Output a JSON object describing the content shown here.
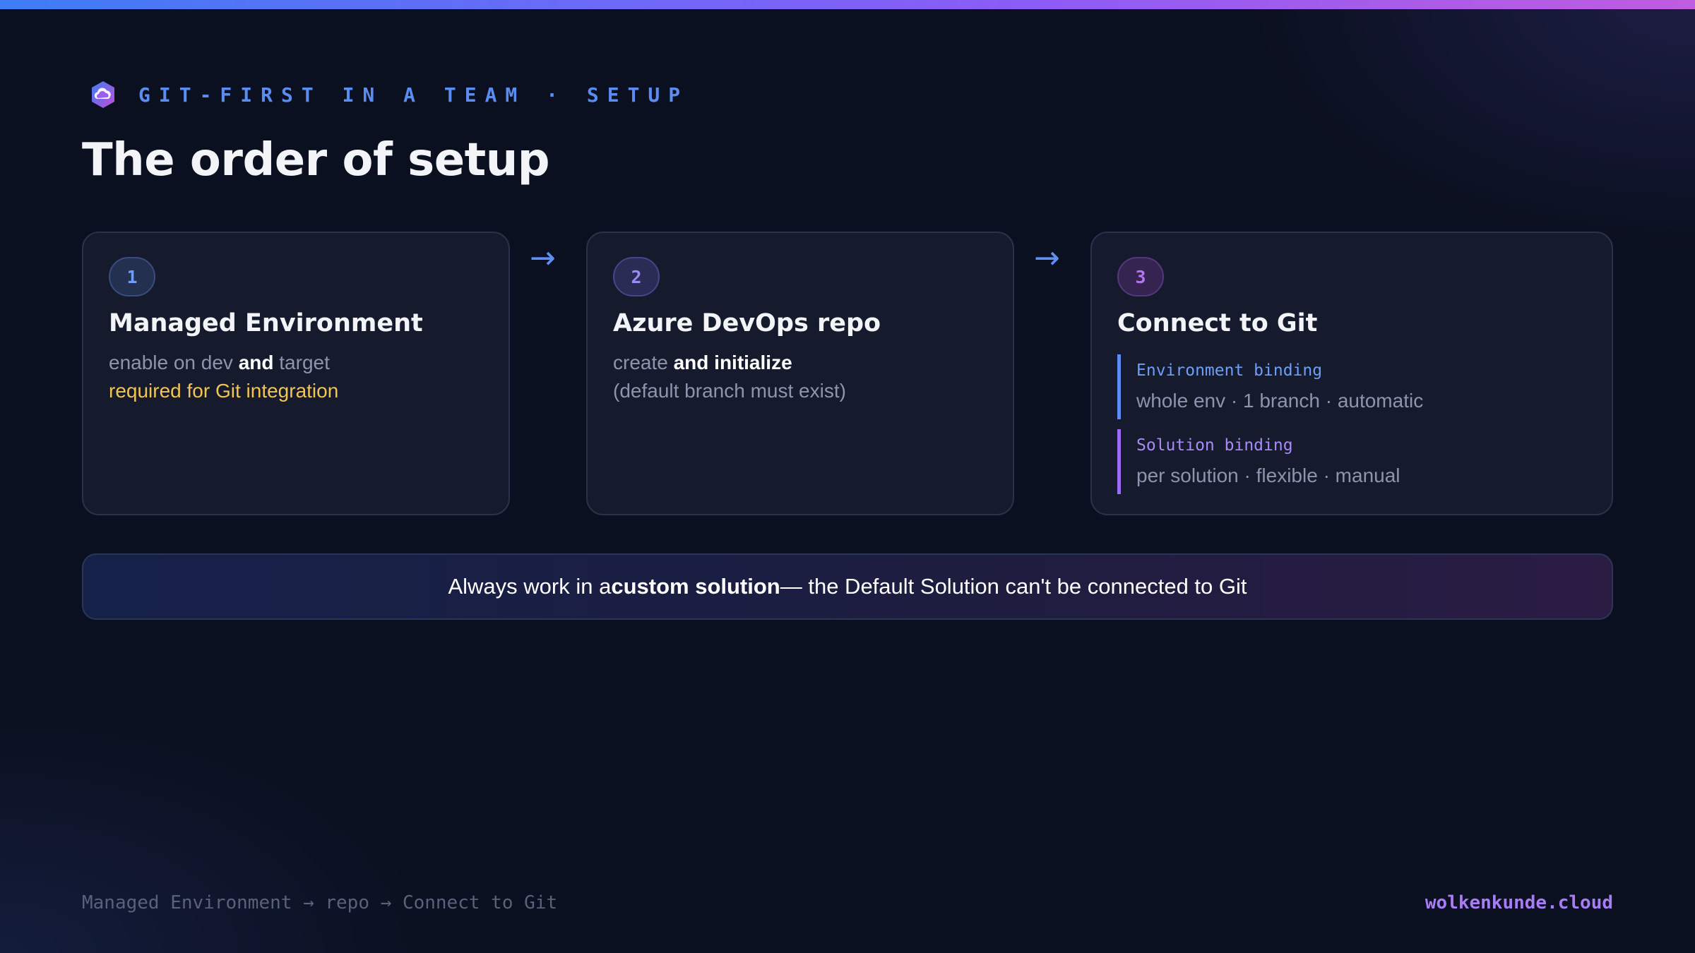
{
  "header": {
    "eyebrow": "GIT-FIRST IN A TEAM · SETUP",
    "title": "The order of setup"
  },
  "steps": [
    {
      "number": "1",
      "title": "Managed Environment",
      "line1": {
        "pre": "enable on dev ",
        "bold": "and",
        "post": " target"
      },
      "line2": "required for Git integration"
    },
    {
      "number": "2",
      "title": "Azure DevOps repo",
      "line1": {
        "pre": "create ",
        "bold": "and initialize"
      },
      "line2": "(default branch must exist)"
    },
    {
      "number": "3",
      "title": "Connect to Git",
      "bindings": [
        {
          "label": "Environment binding",
          "desc": "whole env · 1 branch · automatic"
        },
        {
          "label": "Solution binding",
          "desc": "per solution · flexible · manual"
        }
      ]
    }
  ],
  "arrows": [
    "→",
    "→"
  ],
  "callout": {
    "pre": "Always work in a ",
    "bold": "custom solution",
    "post": " — the Default Solution can't be connected to Git"
  },
  "footer": {
    "left": "Managed Environment → repo → Connect to Git",
    "right": "wolkenkunde.cloud"
  },
  "colors": {
    "background": "#0b1020",
    "accent_blue": "#5b8cf0",
    "accent_purple": "#9a6cf0",
    "warning_yellow": "#f2c452"
  },
  "icons": {
    "logo": "cloud-logo-icon"
  }
}
